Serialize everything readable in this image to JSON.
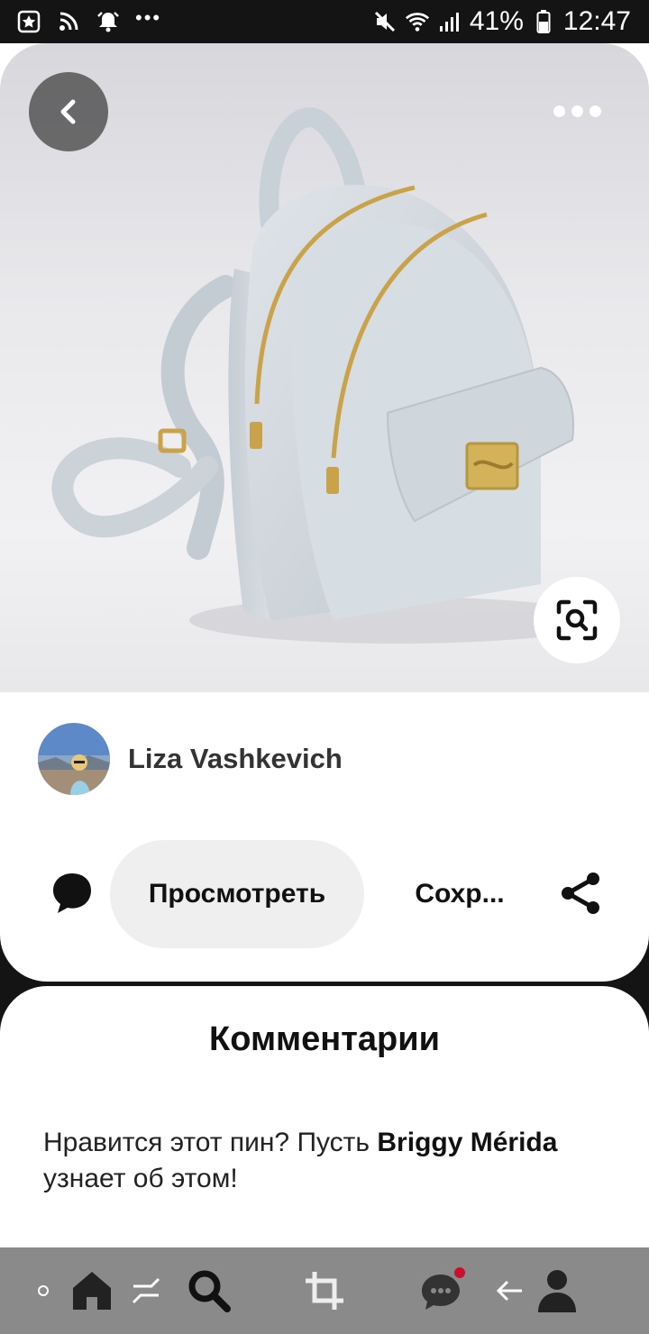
{
  "status_bar": {
    "battery": "41%",
    "time": "12:47",
    "icons": [
      "star-notification-icon",
      "rss-icon",
      "alarm-icon",
      "more-notifications-icon",
      "mute-icon",
      "wifi-icon",
      "signal-icon",
      "battery-icon"
    ]
  },
  "pin": {
    "image_alt": "light grey leather mini backpack",
    "author": {
      "name": "Liza Vashkevich"
    },
    "actions": {
      "view_label": "Просмотреть",
      "save_label": "Сохр..."
    }
  },
  "comments": {
    "title": "Комментарии",
    "prompt_before": "Нравится этот пин? Пусть ",
    "prompt_user": "Briggy Mérida",
    "prompt_after": " узнает об этом!"
  },
  "nav": {
    "icons": [
      "home-icon",
      "swap-icon",
      "search-icon",
      "crop-icon",
      "messages-icon",
      "back-arrow-icon",
      "profile-icon"
    ],
    "messages_badge_color": "#c8102e"
  },
  "colors": {
    "text_primary": "#111111",
    "button_bg": "#efefef",
    "badge": "#c8102e"
  }
}
